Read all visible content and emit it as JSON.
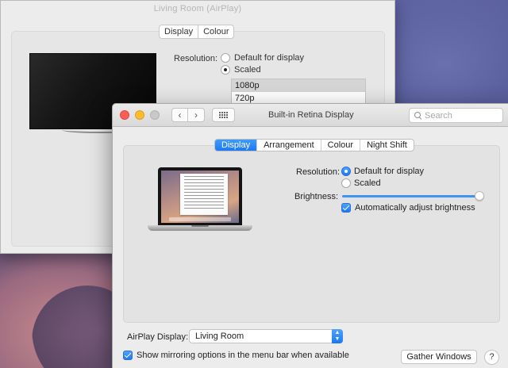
{
  "back_window": {
    "title": "Living Room (AirPlay)",
    "tabs": [
      "Display",
      "Colour"
    ],
    "resolution_label": "Resolution:",
    "options": [
      "Default for display",
      "Scaled"
    ],
    "list": [
      "1080p",
      "720p"
    ]
  },
  "front_window": {
    "title": "Built-in Retina Display",
    "search_placeholder": "Search",
    "nav": {
      "back": "‹",
      "forward": "›"
    },
    "tabs": [
      "Display",
      "Arrangement",
      "Colour",
      "Night Shift"
    ],
    "active_tab": "Display",
    "resolution": {
      "label": "Resolution:",
      "options": [
        "Default for display",
        "Scaled"
      ],
      "selected": "Default for display"
    },
    "brightness": {
      "label": "Brightness:",
      "level": 0.97
    },
    "auto_brightness": {
      "label": "Automatically adjust brightness",
      "checked": true
    },
    "airplay": {
      "label": "AirPlay Display:",
      "value": "Living Room"
    },
    "mirroring": {
      "label": "Show mirroring options in the menu bar when available",
      "checked": true
    },
    "gather_label": "Gather Windows",
    "help_label": "?"
  },
  "colors": {
    "accent": "#1d79f4",
    "close": "#fc5f57",
    "minimize": "#fdbc2e"
  }
}
